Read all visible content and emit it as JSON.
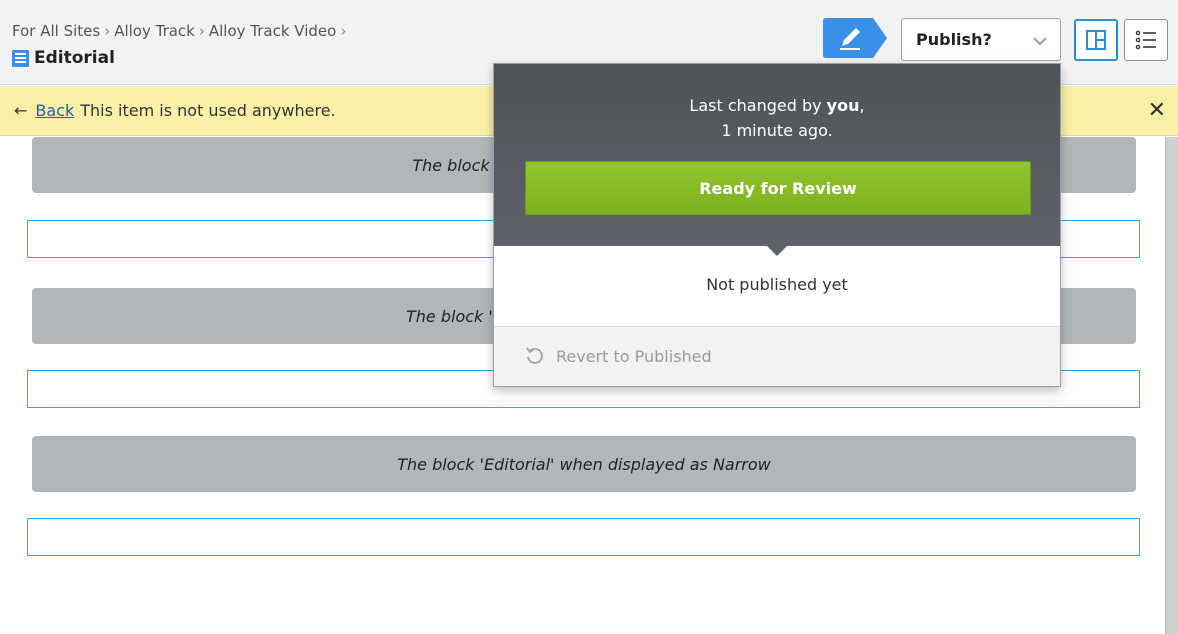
{
  "header": {
    "breadcrumb": [
      "For All Sites",
      "Alloy Track",
      "Alloy Track Video"
    ],
    "breadcrumb_separator": "›",
    "title": "Editorial",
    "publish_label": "Publish?",
    "accent_color": "#3a8fe8"
  },
  "notification": {
    "back_label": "Back",
    "message": "This item is not used anywhere.",
    "close_icon": "close-icon",
    "background_color": "#fbf0a7"
  },
  "blocks": [
    {
      "label": "The block 'Editorial' when displayed as Full"
    },
    {
      "label": "The block 'Editorial' when displayed as Wide"
    },
    {
      "label": "The block 'Editorial' when displayed as Narrow"
    }
  ],
  "publish_popup": {
    "changed_prefix": "Last changed by",
    "changed_user": "you",
    "changed_suffix": ",",
    "changed_time": "1 minute ago.",
    "ready_label": "Ready for Review",
    "status": "Not published yet",
    "revert_label": "Revert to Published",
    "ready_color": "#8cbf26"
  },
  "icons": {
    "edit": "pencil-icon",
    "publish_menu": "chevron-down-icon",
    "view_toggle": [
      "layout-columns-icon",
      "list-icon"
    ],
    "page_type": "page-type-icon",
    "revert": "revert-icon",
    "back": "arrow-left-icon"
  }
}
